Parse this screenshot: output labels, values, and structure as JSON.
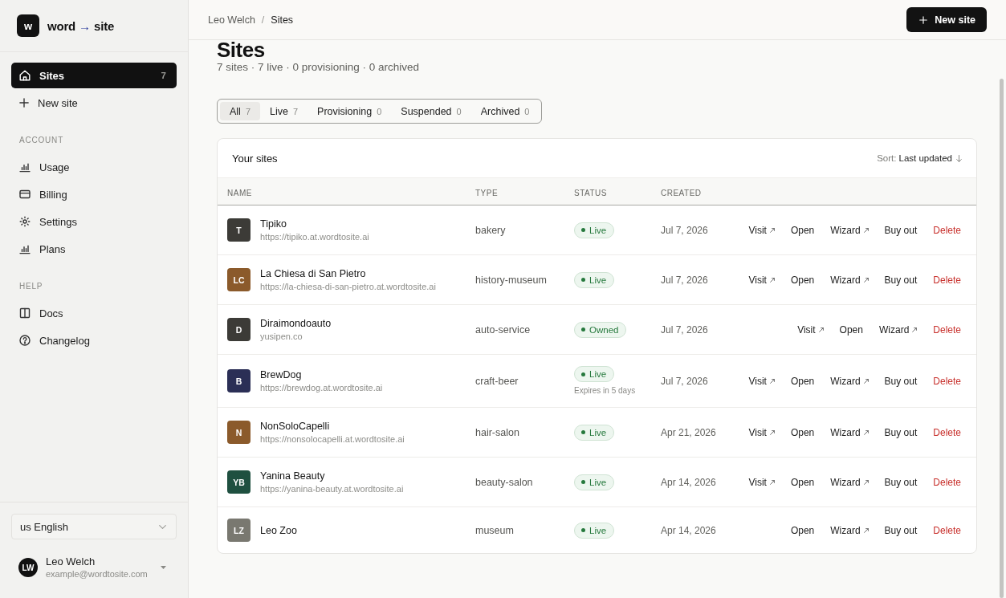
{
  "sidebar": {
    "logo": {
      "mark": "w",
      "name_start": "word",
      "arrow": "→",
      "name_end": "site"
    },
    "nav": [
      {
        "label": "Sites",
        "count": "7",
        "selected": true
      },
      {
        "label": "New site",
        "selected": false
      }
    ],
    "sections": [
      {
        "heading": "ACCOUNT",
        "items": [
          {
            "label": "Usage",
            "selected": false
          },
          {
            "label": "Billing",
            "selected": false
          },
          {
            "label": "Settings",
            "selected": false
          },
          {
            "label": "Plans",
            "selected": false
          }
        ]
      },
      {
        "heading": "HELP",
        "items": [
          {
            "label": "Docs",
            "selected": false
          },
          {
            "label": "Changelog",
            "selected": false
          }
        ]
      }
    ],
    "language": {
      "value": "us English"
    },
    "user": {
      "initials": "LW",
      "name": "Leo Welch",
      "email": "example@wordtosite.com"
    }
  },
  "topbar": {
    "breadcrumb": [
      "Leo Welch",
      "Sites"
    ],
    "separator": "/",
    "button": "New site"
  },
  "page": {
    "title": "Sites",
    "summary": "7 sites · 7 live · 0 provisioning · 0 archived"
  },
  "filters": [
    {
      "label": "All",
      "count": "7",
      "selected": true
    },
    {
      "label": "Live",
      "count": "7",
      "selected": false
    },
    {
      "label": "Provisioning",
      "count": "0",
      "selected": false
    },
    {
      "label": "Suspended",
      "count": "0",
      "selected": false
    },
    {
      "label": "Archived",
      "count": "0",
      "selected": false
    }
  ],
  "table": {
    "title": "Your sites",
    "sort": {
      "label": "Sort:",
      "value": "Last updated"
    },
    "columns": [
      "NAME",
      "TYPE",
      "STATUS",
      "CREATED"
    ],
    "rows": [
      {
        "initials": "T",
        "color": "#3c3b37",
        "name": "Tipiko",
        "url": "https://tipiko.at.wordtosite.ai",
        "type": "bakery",
        "status": "Live",
        "created": "Jul 7, 2026",
        "actions": [
          {
            "label": "Visit",
            "kind": "external"
          },
          {
            "label": "Open",
            "kind": "plain"
          },
          {
            "label": "Wizard",
            "kind": "external"
          },
          {
            "label": "Buy out",
            "kind": "plain"
          },
          {
            "label": "Delete",
            "kind": "danger"
          }
        ]
      },
      {
        "initials": "LC",
        "color": "#8b5a2b",
        "name": "La Chiesa di San Pietro",
        "url": "https://la-chiesa-di-san-pietro.at.wordtosite.ai",
        "type": "history-museum",
        "status": "Live",
        "created": "Jul 7, 2026",
        "actions": [
          {
            "label": "Visit",
            "kind": "external"
          },
          {
            "label": "Open",
            "kind": "plain"
          },
          {
            "label": "Wizard",
            "kind": "external"
          },
          {
            "label": "Buy out",
            "kind": "plain"
          },
          {
            "label": "Delete",
            "kind": "danger"
          }
        ]
      },
      {
        "initials": "D",
        "color": "#3c3b37",
        "name": "Diraimondoauto",
        "url": "yusipen.co",
        "type": "auto-service",
        "status": "Owned",
        "created": "Jul 7, 2026",
        "actions": [
          {
            "label": "Visit",
            "kind": "external"
          },
          {
            "label": "Open",
            "kind": "plain"
          },
          {
            "label": "Wizard",
            "kind": "external"
          },
          {
            "label": "Delete",
            "kind": "danger"
          }
        ]
      },
      {
        "initials": "B",
        "color": "#2b2f56",
        "name": "BrewDog",
        "url": "https://brewdog.at.wordtosite.ai",
        "type": "craft-beer",
        "status": "Live",
        "note": "Expires in 5 days",
        "created": "Jul 7, 2026",
        "actions": [
          {
            "label": "Visit",
            "kind": "external"
          },
          {
            "label": "Open",
            "kind": "plain"
          },
          {
            "label": "Wizard",
            "kind": "external"
          },
          {
            "label": "Buy out",
            "kind": "plain"
          },
          {
            "label": "Delete",
            "kind": "danger"
          }
        ]
      },
      {
        "initials": "N",
        "color": "#8b5a2b",
        "name": "NonSoloCapelli",
        "url": "https://nonsolocapelli.at.wordtosite.ai",
        "type": "hair-salon",
        "status": "Live",
        "created": "Apr 21, 2026",
        "actions": [
          {
            "label": "Visit",
            "kind": "external"
          },
          {
            "label": "Open",
            "kind": "plain"
          },
          {
            "label": "Wizard",
            "kind": "external"
          },
          {
            "label": "Buy out",
            "kind": "plain"
          },
          {
            "label": "Delete",
            "kind": "danger"
          }
        ]
      },
      {
        "initials": "YB",
        "color": "#1f5040",
        "name": "Yanina Beauty",
        "url": "https://yanina-beauty.at.wordtosite.ai",
        "type": "beauty-salon",
        "status": "Live",
        "created": "Apr 14, 2026",
        "actions": [
          {
            "label": "Visit",
            "kind": "external"
          },
          {
            "label": "Open",
            "kind": "plain"
          },
          {
            "label": "Wizard",
            "kind": "external"
          },
          {
            "label": "Buy out",
            "kind": "plain"
          },
          {
            "label": "Delete",
            "kind": "danger"
          }
        ]
      },
      {
        "initials": "LZ",
        "color": "#797870",
        "name": "Leo Zoo",
        "type": "museum",
        "status": "Live",
        "created": "Apr 14, 2026",
        "actions": [
          {
            "label": "Open",
            "kind": "plain"
          },
          {
            "label": "Wizard",
            "kind": "external"
          },
          {
            "label": "Buy out",
            "kind": "plain"
          },
          {
            "label": "Delete",
            "kind": "danger"
          }
        ]
      }
    ]
  }
}
